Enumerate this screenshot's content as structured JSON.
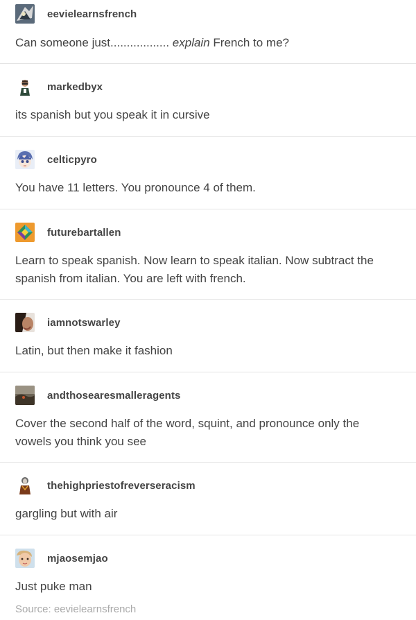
{
  "posts": [
    {
      "username": "eevielearnsfrench",
      "avatar": "pokemon-avatar-icon",
      "text_before": "Can someone just",
      "text_dots": "..................",
      "text_italic": " explain",
      "text_after": " French to me?"
    },
    {
      "username": "markedbyx",
      "avatar": "person-avatar-icon",
      "text": "its spanish but you speak it in cursive"
    },
    {
      "username": "celticpyro",
      "avatar": "anime-avatar-icon",
      "text": "You have 11 letters. You pronounce 4 of them."
    },
    {
      "username": "futurebartallen",
      "avatar": "diamond-logo-avatar-icon",
      "text": "Learn to speak spanish. Now learn to speak italian. Now subtract the spanish from italian. You are left with french."
    },
    {
      "username": "iamnotswarley",
      "avatar": "portrait-avatar-icon",
      "text": "Latin, but then make it fashion"
    },
    {
      "username": "andthosearesmalleragents",
      "avatar": "landscape-avatar-icon",
      "text": "Cover the second half of the word, squint, and pronounce only the vowels you think you see"
    },
    {
      "username": "thehighpriestofreverseracism",
      "avatar": "figure-avatar-icon",
      "text": "gargling but with air"
    },
    {
      "username": "mjaosemjao",
      "avatar": "selfie-avatar-icon",
      "text": "Just puke man"
    }
  ],
  "source_label": "Source: eevielearnsfrench",
  "colors": {
    "text": "#444444",
    "divider": "#e4e4e4",
    "source": "#a9a9a9"
  }
}
